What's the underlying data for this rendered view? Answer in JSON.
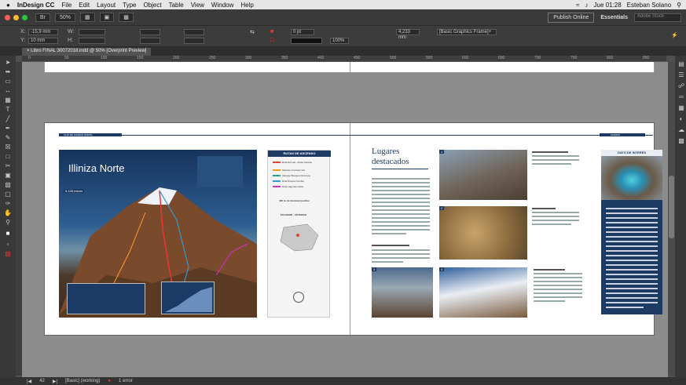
{
  "menubar": {
    "apple": "",
    "app_name": "InDesign CC",
    "items": [
      "File",
      "Edit",
      "Layout",
      "Type",
      "Object",
      "Table",
      "View",
      "Window",
      "Help"
    ],
    "clock": "Jue 01:28",
    "user": "Esteban Solano"
  },
  "appbar": {
    "zoom": "50%",
    "publish_label": "Publish Online",
    "workspace": "Essentials",
    "search_placeholder": "Adobe Stock"
  },
  "control": {
    "x_label": "X:",
    "x_value": "-15,9 mm",
    "y_label": "Y:",
    "y_value": "10 mm",
    "w_label": "W:",
    "h_label": "H:",
    "stroke_weight": "0 pt",
    "opacity": "100%",
    "spacing": "4,233 mm",
    "frame_style": "[Basic Graphics Frame]+"
  },
  "doc_tab": "Libro FINAL 30072018.indd @ 50% [Overprint Preview]",
  "ruler": [
    "0",
    "50",
    "100",
    "150",
    "200",
    "250",
    "300",
    "350",
    "400",
    "450",
    "500",
    "550",
    "600",
    "650",
    "700",
    "750",
    "800",
    "850"
  ],
  "spread": {
    "left_header": "GUÍA DE ILINIZAS NORTE",
    "right_header": "ILINIZAS",
    "map_title": "Illiniza Norte",
    "map_altitude": "5.126 msnm",
    "legend_title": "RUTAS DE ASCENSO",
    "legend_items": [
      {
        "label": "Ruta Normal - Arista Sureste",
        "color": "#d43"
      },
      {
        "label": "Variante Corredor Vía",
        "color": "#f90"
      },
      {
        "label": "Variante Bosques Rocosos",
        "color": "#2a8"
      },
      {
        "label": "Ruta Directa Cumbre",
        "color": "#39c"
      },
      {
        "label": "Ruta Lagunas Noble",
        "color": "#c3c"
      }
    ],
    "legend_scale": "400 m. de desnivel positivo",
    "legend_country": "ECUADOR - COTOPAXI",
    "title_line1": "Lugares",
    "title_line2": "destacados",
    "photo_labels": [
      "1",
      "2",
      "3",
      "4"
    ],
    "interest_title": "DATO DE INTERÉS"
  },
  "statusbar": {
    "page": "42",
    "style": "[Basic] (working)",
    "errors": "1 error"
  }
}
